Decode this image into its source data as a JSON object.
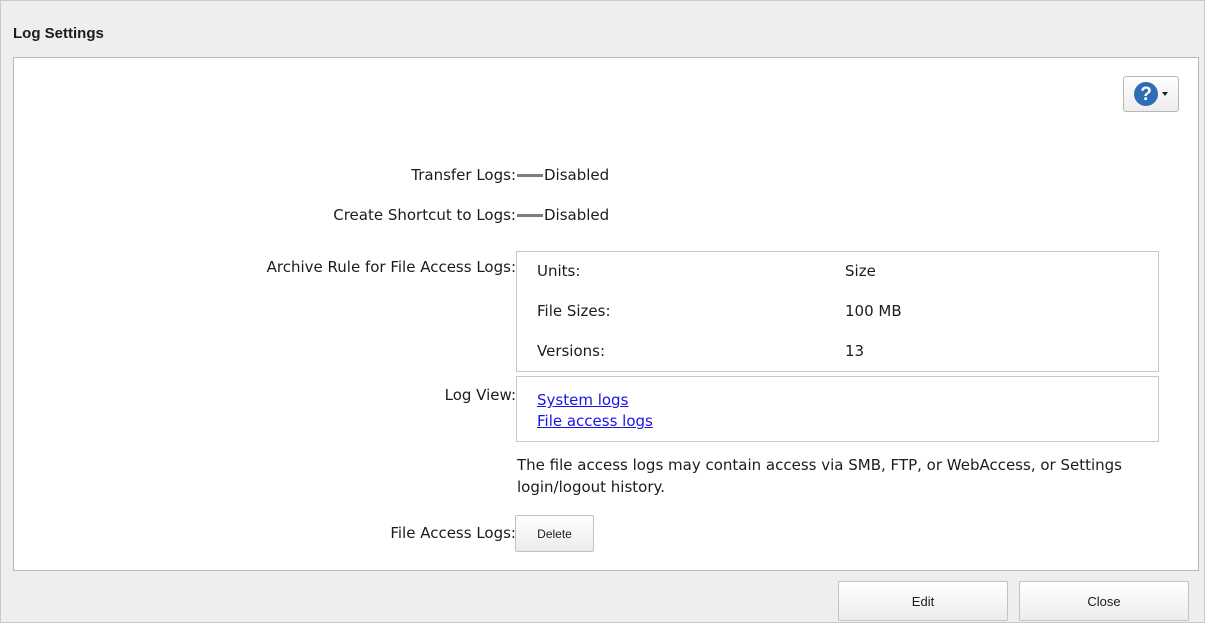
{
  "window": {
    "title": "Log Settings"
  },
  "help": {
    "icon": "help-icon",
    "glyph": "?"
  },
  "settings": {
    "transfer_logs": {
      "label": "Transfer Logs:",
      "value": "Disabled"
    },
    "shortcut_logs": {
      "label": "Create Shortcut to Logs:",
      "value": "Disabled"
    },
    "archive_rule": {
      "label": "Archive Rule for File Access Logs:",
      "rows": [
        {
          "name": "Units:",
          "value": "Size"
        },
        {
          "name": "File Sizes:",
          "value": "100 MB"
        },
        {
          "name": "Versions:",
          "value": "13"
        }
      ]
    },
    "log_view": {
      "label": "Log View:",
      "links": [
        "System logs",
        "File access logs"
      ]
    },
    "note": "The file access logs may contain access via SMB, FTP, or WebAccess, or Settings login/logout history.",
    "file_access_logs": {
      "label": "File Access Logs:",
      "button": "Delete"
    }
  },
  "footer": {
    "edit_label": "Edit",
    "close_label": "Close"
  },
  "colors": {
    "link": "#1a14e8",
    "help_blue": "#2d6db5"
  }
}
